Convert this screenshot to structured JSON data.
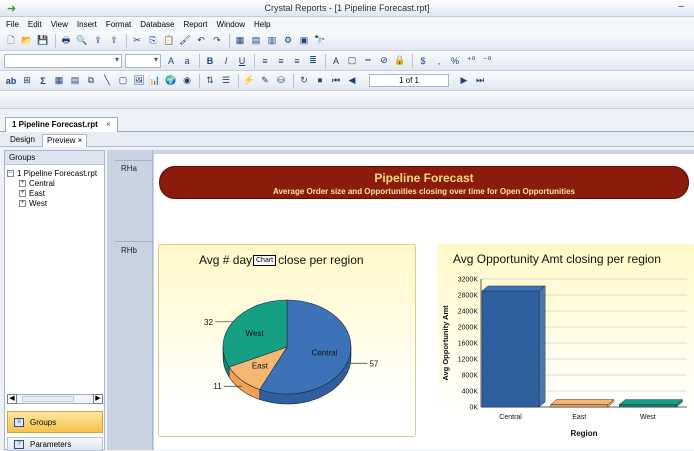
{
  "window": {
    "title": "Crystal Reports - [1 Pipeline Forecast.rpt]",
    "minimize": "–"
  },
  "menu": [
    "File",
    "Edit",
    "View",
    "Insert",
    "Format",
    "Database",
    "Report",
    "Window",
    "Help"
  ],
  "toolbar": {
    "page_indicator": "1 of 1"
  },
  "document_tab": {
    "label": "1 Pipeline Forecast.rpt",
    "close": "×"
  },
  "view_tabs": {
    "design": "Design",
    "preview": "Preview ×"
  },
  "left_panel": {
    "header": "Groups",
    "root": "1 Pipeline Forecast.rpt",
    "items": [
      "Central",
      "East",
      "West"
    ],
    "groups_button": "Groups",
    "parameters_button": "Parameters"
  },
  "sections": {
    "rha": "RHa",
    "rhb": "RHb"
  },
  "banner": {
    "title": "Pipeline Forecast",
    "subtitle": "Average Order size and Opportunities closing over time for Open Opportunities"
  },
  "tooltip": "Chart",
  "colors": {
    "central": "#2f5f9e",
    "central_top": "#3d72b8",
    "east": "#f2a054",
    "east_top": "#f7b672",
    "west": "#11866b",
    "west_top": "#16a083",
    "banner": "#8b1b0a"
  },
  "chart_data": [
    {
      "type": "pie",
      "title_left": "Avg # day",
      "title_right": "close per region",
      "categories": [
        "Central",
        "East",
        "West"
      ],
      "values": [
        57,
        11,
        32
      ],
      "labels": [
        {
          "category": "Central",
          "text": "Central"
        },
        {
          "category": "East",
          "text": "East"
        },
        {
          "category": "West",
          "text": "West"
        }
      ]
    },
    {
      "type": "bar",
      "title": "Avg Opportunity Amt closing per region",
      "xlabel": "Region",
      "ylabel": "Avg Opportunity Amt",
      "categories": [
        "Central",
        "East",
        "West"
      ],
      "values": [
        2900,
        60,
        60
      ],
      "ylim": [
        0,
        3200
      ],
      "ytick_labels": [
        "0K",
        "400K",
        "800K",
        "1200K",
        "1600K",
        "2000K",
        "2400K",
        "2800K",
        "3200K"
      ],
      "grid": true
    }
  ]
}
